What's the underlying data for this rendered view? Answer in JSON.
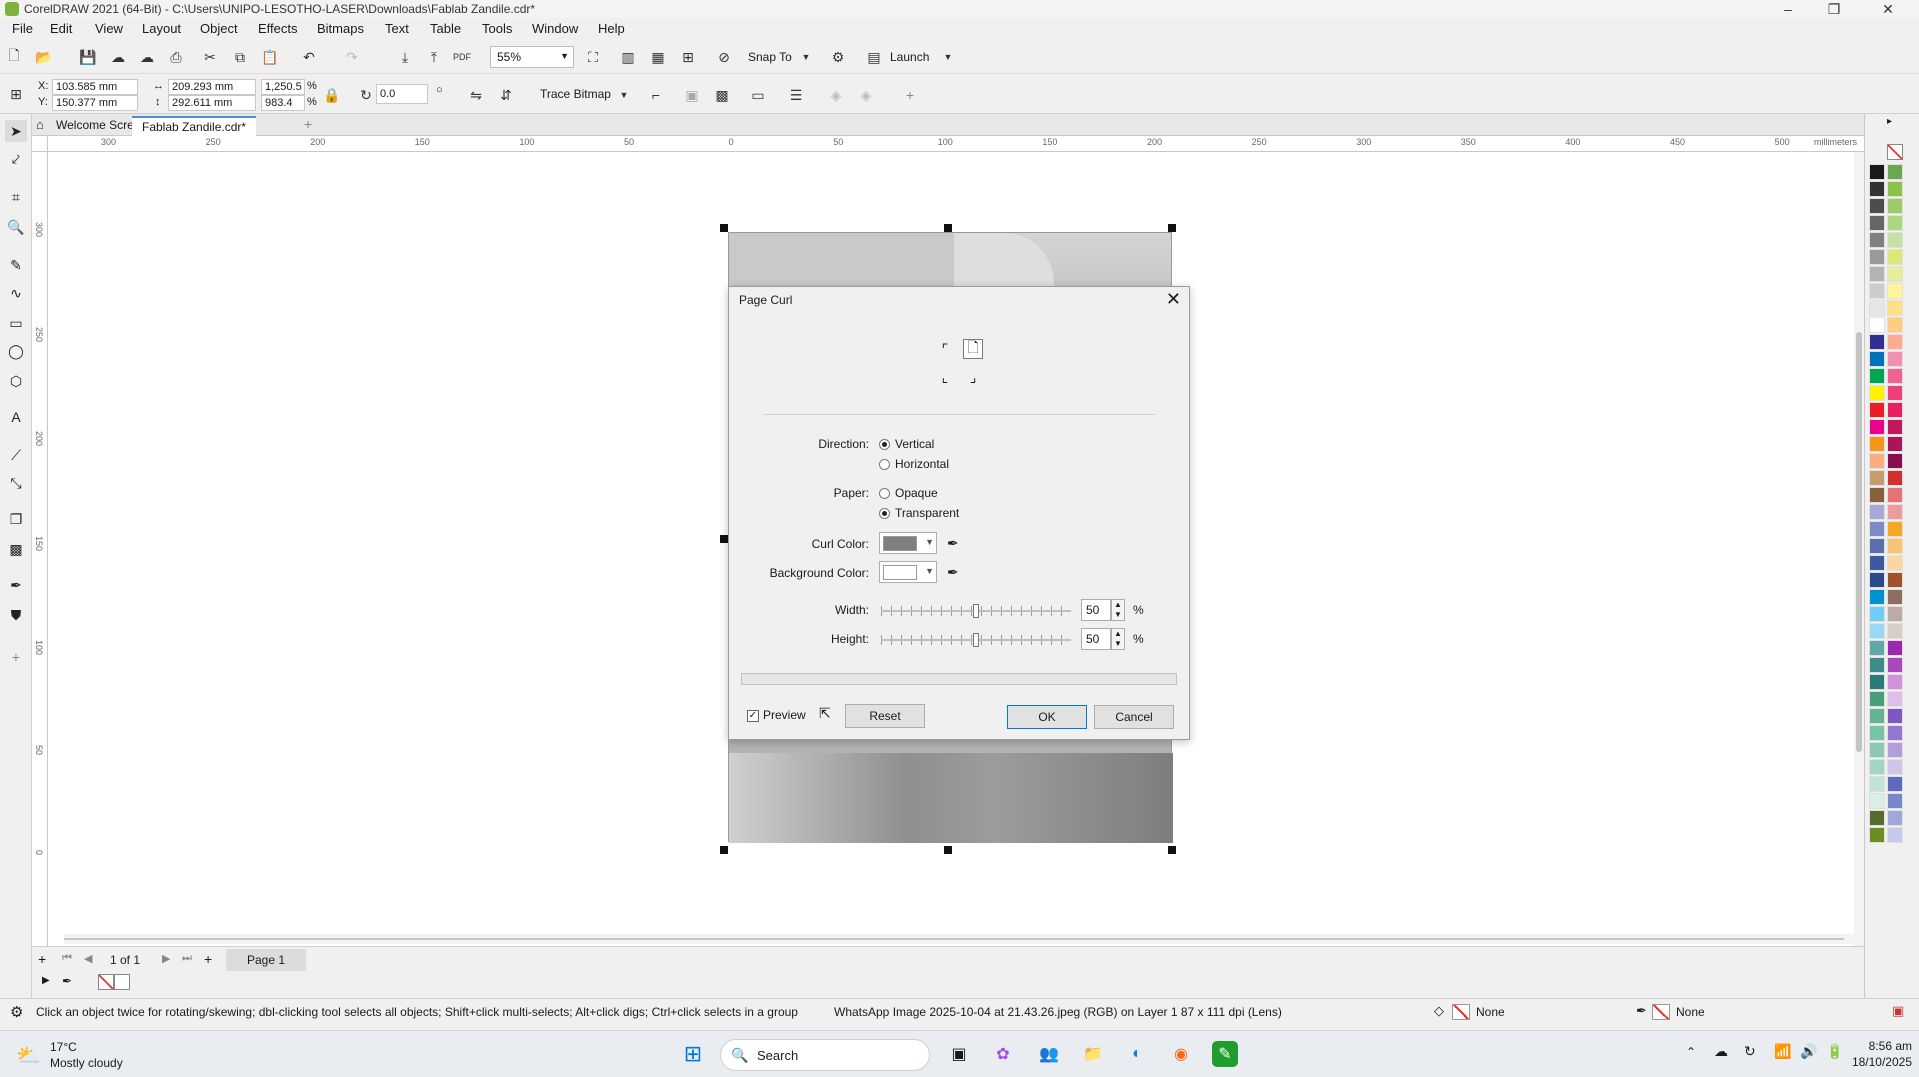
{
  "app": {
    "title": "CorelDRAW 2021 (64-Bit) - C:\\Users\\UNIPO-LESOTHO-LASER\\Downloads\\Fablab Zandile.cdr*"
  },
  "menu": [
    "File",
    "Edit",
    "View",
    "Layout",
    "Object",
    "Effects",
    "Bitmaps",
    "Text",
    "Table",
    "Tools",
    "Window",
    "Help"
  ],
  "toolbar1": {
    "zoom": "55%",
    "snap_to": "Snap To",
    "launch": "Launch"
  },
  "toolbar2": {
    "x_label": "X:",
    "x_value": "103.585 mm",
    "y_label": "Y:",
    "y_value": "150.377 mm",
    "width_value": "209.293 mm",
    "height_value": "292.611 mm",
    "scale_x": "1,250.5",
    "scale_y": "983.4",
    "pct": "%",
    "angle": "0.0",
    "trace_bitmap": "Trace Bitmap"
  },
  "tabs": {
    "welcome": "Welcome Screen",
    "document": "Fablab Zandile.cdr*"
  },
  "ruler": {
    "units": "millimeters",
    "h_ticks": [
      "300",
      "250",
      "200",
      "150",
      "100",
      "50",
      "0",
      "50",
      "100",
      "150",
      "200",
      "250",
      "300",
      "350",
      "400",
      "450",
      "500"
    ],
    "v_ticks": [
      "300",
      "250",
      "200",
      "150",
      "100",
      "50",
      "0"
    ]
  },
  "dialog": {
    "title": "Page Curl",
    "direction_label": "Direction:",
    "vertical": "Vertical",
    "horizontal": "Horizontal",
    "paper_label": "Paper:",
    "opaque": "Opaque",
    "transparent": "Transparent",
    "curl_color_label": "Curl Color:",
    "background_color_label": "Background Color:",
    "width_label": "Width:",
    "width_value": "50",
    "height_label": "Height:",
    "height_value": "50",
    "percent": "%",
    "preview": "Preview",
    "reset": "Reset",
    "ok": "OK",
    "cancel": "Cancel",
    "curl_color": "#7f7f7f",
    "background_color": "#ffffff",
    "width_fraction": 0.5,
    "height_fraction": 0.5,
    "selected_direction": "Vertical",
    "selected_paper": "Transparent",
    "preview_checked": true
  },
  "pagebar": {
    "page_count": "1 of 1",
    "page_tab": "Page 1"
  },
  "status": {
    "hint": "Click an object twice for rotating/skewing; dbl-clicking tool selects all objects; Shift+click multi-selects; Alt+click digs; Ctrl+click selects in a group",
    "object_info": "WhatsApp Image 2025-10-04 at 21.43.26.jpeg (RGB) on Layer 1 87 x 111 dpi  (Lens)",
    "fill_none": "None",
    "outline_none": "None"
  },
  "taskbar": {
    "temperature": "17°C",
    "weather": "Mostly cloudy",
    "search": "Search",
    "time": "8:56 am",
    "date": "18/10/2025"
  },
  "palette_colors": [
    "#1a1a1a",
    "#333333",
    "#4d4d4d",
    "#666666",
    "#808080",
    "#999999",
    "#b3b3b3",
    "#cccccc",
    "#e6e6e6",
    "#ffffff",
    "#2e3192",
    "#0072bc",
    "#00a651",
    "#fff200",
    "#ed1c24",
    "#ec008c",
    "#f7941d",
    "#f9ad81",
    "#c69c6d",
    "#8b5e3c",
    "#a8a8d8",
    "#7b8cc4",
    "#5a6fb0",
    "#3e5a9e",
    "#2c4a8a",
    "#0093d0",
    "#6dcff6",
    "#9ad9f5",
    "#5fa8a6",
    "#3c8c88",
    "#2d7b77",
    "#45a07a",
    "#62b58f",
    "#79c4a0",
    "#8dc8b5",
    "#a2d5c6",
    "#bfe3d6",
    "#d7efe6",
    "#556b2f",
    "#6b8e23"
  ],
  "palette_colors_2": [
    "#6aa84f",
    "#8bc34a",
    "#9ccc65",
    "#aed581",
    "#c5e1a5",
    "#dce775",
    "#e6ee9c",
    "#fff59d",
    "#ffe082",
    "#ffcc80",
    "#ffab91",
    "#f48fb1",
    "#f06292",
    "#ec407a",
    "#e91e63",
    "#c2185b",
    "#ad1457",
    "#880e4f",
    "#d32f2f",
    "#e57373",
    "#ef9a9a",
    "#f5a623",
    "#f8c471",
    "#fad7a0",
    "#a0522d",
    "#8d6e63",
    "#bcaaa4",
    "#d7ccc8",
    "#9c27b0",
    "#ab47bc",
    "#ce93d8",
    "#e1bee7",
    "#7e57c2",
    "#9575cd",
    "#b39ddb",
    "#d1c4e9",
    "#5c6bc0",
    "#7986cb",
    "#9fa8da",
    "#c5cae9"
  ]
}
